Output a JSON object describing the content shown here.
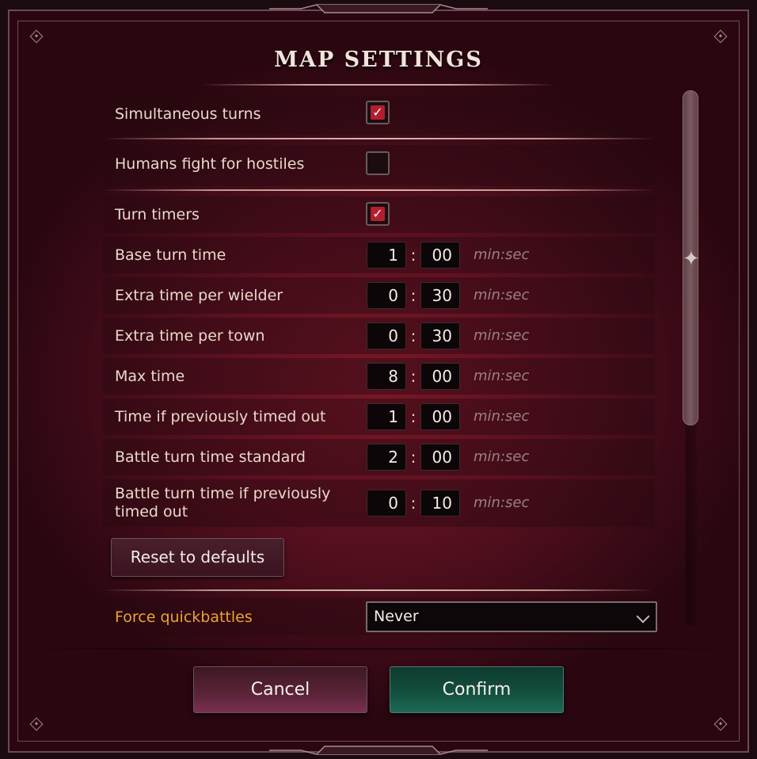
{
  "dialog": {
    "title": "MAP SETTINGS"
  },
  "settings": {
    "simultaneous_turns": {
      "label": "Simultaneous turns",
      "checked": true
    },
    "humans_fight": {
      "label": "Humans fight for hostiles",
      "checked": false
    },
    "turn_timers": {
      "label": "Turn timers",
      "checked": true
    },
    "timers": [
      {
        "label": "Base turn time",
        "min": "1",
        "sec": "00",
        "unit": "min:sec"
      },
      {
        "label": "Extra time per wielder",
        "min": "0",
        "sec": "30",
        "unit": "min:sec"
      },
      {
        "label": "Extra time per town",
        "min": "0",
        "sec": "30",
        "unit": "min:sec"
      },
      {
        "label": "Max time",
        "min": "8",
        "sec": "00",
        "unit": "min:sec"
      },
      {
        "label": "Time if previously timed out",
        "min": "1",
        "sec": "00",
        "unit": "min:sec"
      },
      {
        "label": "Battle turn time standard",
        "min": "2",
        "sec": "00",
        "unit": "min:sec"
      },
      {
        "label": "Battle turn time if previously timed out",
        "min": "0",
        "sec": "10",
        "unit": "min:sec"
      }
    ],
    "colon": ":",
    "reset_label": "Reset to defaults",
    "force_quickbattles": {
      "label": "Force quickbattles",
      "value": "Never"
    }
  },
  "footer": {
    "cancel_label": "Cancel",
    "confirm_label": "Confirm"
  },
  "colors": {
    "accent_orange": "#e8a534",
    "confirm_green": "#145040",
    "checkbox_red": "#b31e2e"
  }
}
